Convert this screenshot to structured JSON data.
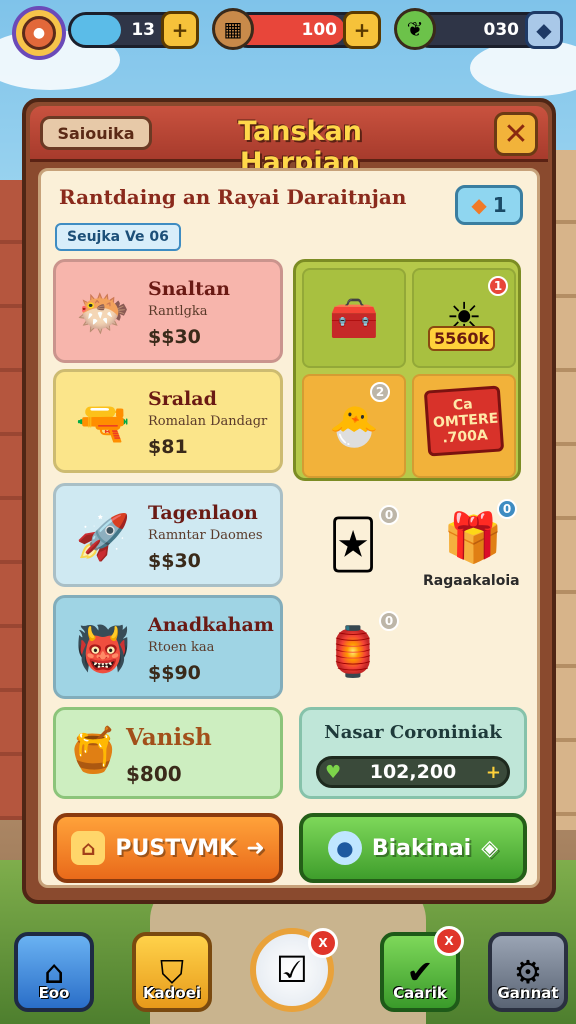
{
  "topbar": {
    "resources": [
      {
        "value": "13",
        "icon": "plus-icon"
      },
      {
        "value": "100",
        "icon": "plus-icon"
      },
      {
        "value": "030",
        "icon": "diamond-icon"
      }
    ]
  },
  "panel": {
    "back_tab": "Saiouika",
    "title": "Tanskan Harpian",
    "subtitle": "Rantdaing an Rayai Daraitnjan",
    "count_badge": "1",
    "section_tag": "Seujka Ve 06"
  },
  "items": [
    {
      "name": "Snaltan",
      "desc": "Rantlgka",
      "price": "$$30"
    },
    {
      "name": "Sralad",
      "desc": "Romalan Dandagr",
      "price": "$81"
    },
    {
      "name": "Tagenlaon",
      "desc": "Ramntar Daomes",
      "price": "$$30"
    },
    {
      "name": "Anadkaham",
      "desc": "Rtoen kaa",
      "price": "$$90"
    }
  ],
  "grid": {
    "sun_label": "5560k",
    "sun_badge": "1",
    "grey_badge": "2",
    "sale_tag_line1": "Ca",
    "sale_tag_line2": "OMTERE",
    "sale_tag_line3": ".700A"
  },
  "loose": {
    "badge_a": "0",
    "badge_b": "0",
    "badge_c": "0",
    "label": "Ragaakaloia"
  },
  "vanish": {
    "name": "Vanish",
    "price": "$800"
  },
  "currency": {
    "name": "Nasar Coroniniak",
    "value": "102,200"
  },
  "buttons": {
    "purchase": "PUSTVMK",
    "bracket": "Biakinai"
  },
  "nav": {
    "items": [
      {
        "label": "Eoo"
      },
      {
        "label": "Kadoei"
      },
      {
        "label": "Caarik"
      },
      {
        "label": "Gannat"
      }
    ],
    "center_badge": "X",
    "caarik_badge": "X"
  },
  "colors": {
    "panel_header": "#c9523f",
    "gold_title": "#ffd84a",
    "orange_button": "#f08a2a",
    "green_button": "#5ec244"
  }
}
